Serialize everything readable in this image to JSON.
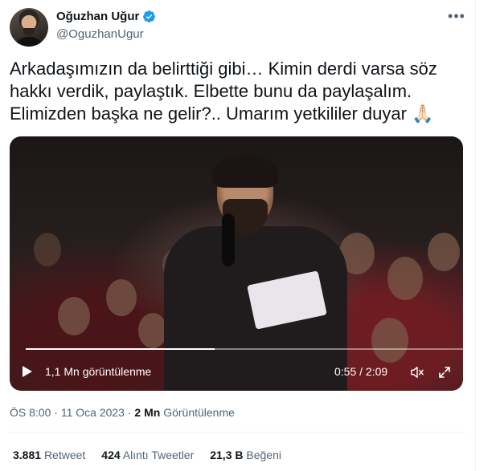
{
  "author": {
    "display_name": "Oğuzhan Uğur",
    "handle": "@OguzhanUgur",
    "verified": true
  },
  "more_icon": "more-horizontal-icon",
  "tweet": {
    "text_line1": "Arkadaşımızın da belirttiği gibi… Kimin derdi varsa söz",
    "text_line2": "hakkı verdik, paylaştık. Elbette bunu da paylaşalım.",
    "text_line3": "Elimizden başka ne gelir?.. Umarım yetkililer duyar",
    "emoji": "🙏🏻"
  },
  "video": {
    "views_label": "1,1 Mn görüntülenme",
    "time_label": "0:55 / 2:09",
    "progress_fraction": 0.43
  },
  "meta": {
    "time": "ÖS 8:00",
    "separator": "·",
    "date": "11 Oca 2023",
    "views_value": "2 Mn",
    "views_label": "Görüntülenme"
  },
  "stats": {
    "retweets_value": "3.881",
    "retweets_label": "Retweet",
    "quotes_value": "424",
    "quotes_label": "Alıntı Tweetler",
    "likes_value": "21,3 B",
    "likes_label": "Beğeni"
  },
  "colors": {
    "accent": "#1d9bf0",
    "text": "#0f1419",
    "secondary": "#536471"
  }
}
